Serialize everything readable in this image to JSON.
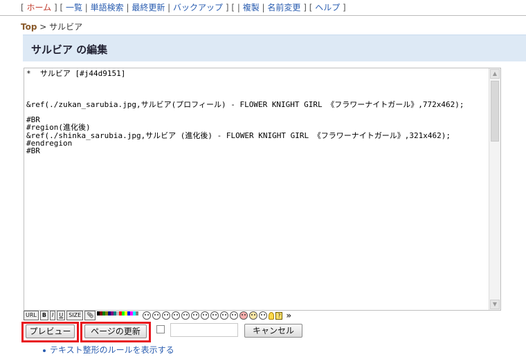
{
  "topnav": {
    "items": [
      "ホーム",
      "一覧",
      "単語検索",
      "最終更新",
      "バックアップ",
      "複製",
      "名前変更",
      "ヘルプ"
    ]
  },
  "breadcrumb": {
    "top": "Top",
    "sep": ">",
    "current": "サルビア"
  },
  "page": {
    "title": "サルビア の編集"
  },
  "editor": {
    "content": "*  サルビア [#j44d9151]\n\n\n\n&ref(./zukan_sarubia.jpg,サルビア(プロフィール) - FLOWER KNIGHT GIRL 《フラワーナイトガール》,772x462);\n\n#BR\n#region(進化後)\n&ref(./shinka_sarubia.jpg,サルビア (進化後) - FLOWER KNIGHT GIRL 《フラワーナイトガール》,321x462);\n#endregion\n#BR"
  },
  "toolbar": {
    "url": "URL",
    "bold": "B",
    "italic": "I",
    "underline": "U",
    "size": "SIZE",
    "more": "»"
  },
  "buttons": {
    "preview": "プレビュー",
    "update": "ページの更新",
    "cancel": "キャンセル"
  },
  "rule_link": "テキスト整形のルールを表示する",
  "colors": {
    "highlight": "#e8141b",
    "title_bg": "#dde9f5",
    "link": "#2a5db0"
  }
}
